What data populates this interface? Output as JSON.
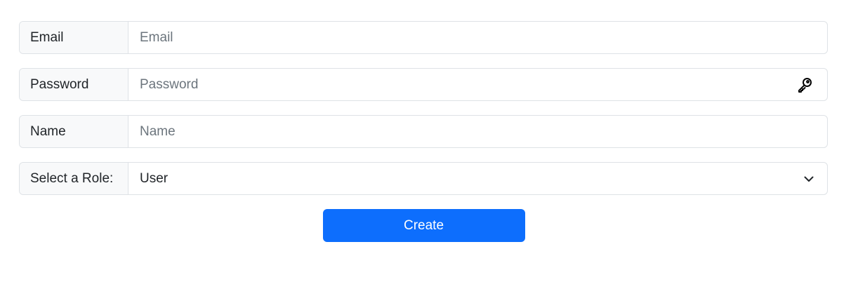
{
  "form": {
    "email": {
      "label": "Email",
      "placeholder": "Email",
      "value": ""
    },
    "password": {
      "label": "Password",
      "placeholder": "Password",
      "value": "",
      "icon": "key-icon"
    },
    "name": {
      "label": "Name",
      "placeholder": "Name",
      "value": ""
    },
    "role": {
      "label": "Select a Role:",
      "selected": "User",
      "icon": "chevron-down-icon"
    },
    "submit_label": "Create"
  },
  "colors": {
    "primary": "#0d6efd",
    "addon_bg": "#f8f9fa",
    "border": "#dee2e6",
    "placeholder": "#6c757d"
  }
}
